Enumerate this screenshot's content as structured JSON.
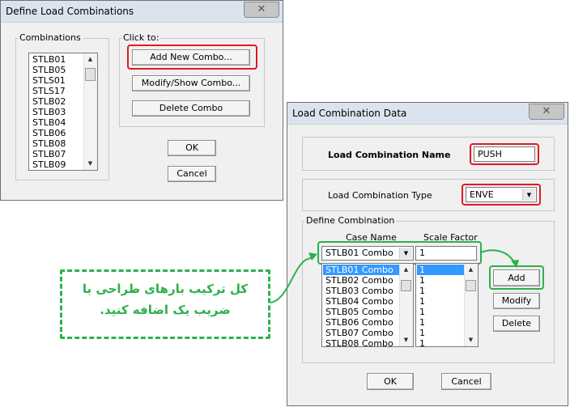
{
  "dialog1": {
    "title": "Define Load Combinations",
    "combinations_label": "Combinations",
    "combinations": [
      "STLB01",
      "STLB05",
      "STLS01",
      "STLS17",
      "STLB02",
      "STLB03",
      "STLB04",
      "STLB06",
      "STLB08",
      "STLB07",
      "STLB09"
    ],
    "click_to_label": "Click to:",
    "add_new_combo": "Add New Combo...",
    "modify_show_combo": "Modify/Show Combo...",
    "delete_combo": "Delete Combo",
    "ok": "OK",
    "cancel": "Cancel"
  },
  "dialog2": {
    "title": "Load Combination Data",
    "name_label": "Load Combination Name",
    "name_value": "PUSH",
    "type_label": "Load Combination Type",
    "type_value": "ENVE",
    "define_label": "Define Combination",
    "case_name_header": "Case Name",
    "scale_factor_header": "Scale Factor",
    "case_dropdown_value": "STLB01 Combo",
    "scale_input_value": "1",
    "cases": [
      "STLB01 Combo",
      "STLB02 Combo",
      "STLB03 Combo",
      "STLB04 Combo",
      "STLB05 Combo",
      "STLB06 Combo",
      "STLB07 Combo",
      "STLB08 Combo"
    ],
    "factors": [
      "1",
      "1",
      "1",
      "1",
      "1",
      "1",
      "1",
      "1"
    ],
    "add": "Add",
    "modify": "Modify",
    "delete": "Delete",
    "ok": "OK",
    "cancel": "Cancel"
  },
  "annotation": {
    "line1": "کل ترکیب بارهای طراحی با",
    "line2": "ضریب یک اضافه کنید."
  },
  "colors": {
    "highlight_red": "#e01a22",
    "highlight_green": "#2bb24c",
    "selection_blue": "#3399ff"
  }
}
